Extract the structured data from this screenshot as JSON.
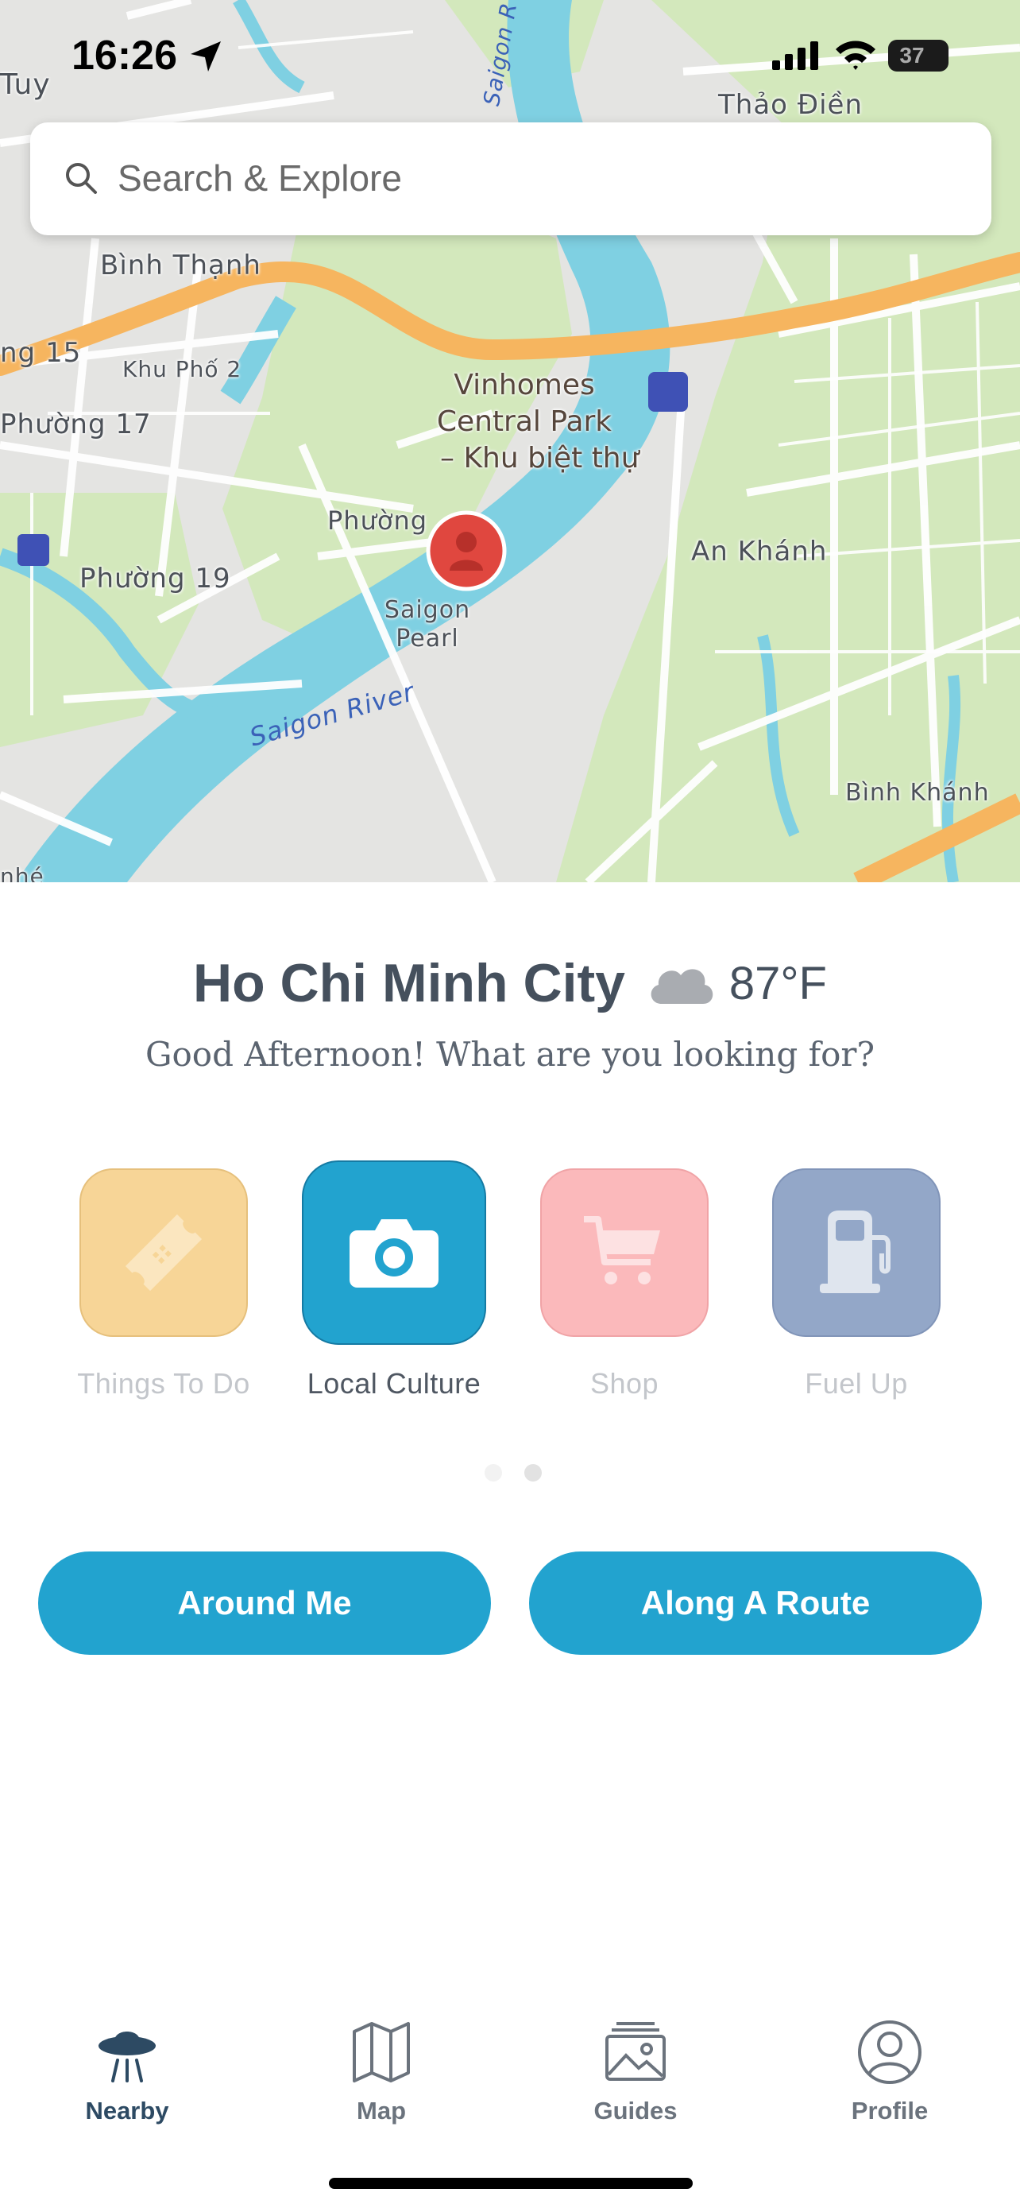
{
  "status_bar": {
    "time": "16:26",
    "battery": "37"
  },
  "search": {
    "placeholder": "Search & Explore",
    "icon": "magnifier-icon"
  },
  "map": {
    "labels": {
      "tuy": "Tuy",
      "thao_dien": "Thảo Điền",
      "binh_thanh": "Bình Thạnh",
      "ng15": "ng 15",
      "khu_pho_2": "Khu Phố 2",
      "phuong17": "Phường 17",
      "poi_line1": "Vinhomes",
      "poi_line2": "Central Park",
      "poi_line3": "– Khu biệt thự",
      "phuong_partial": "Phường",
      "an_khanh": "An Khánh",
      "phuong19": "Phường 19",
      "saigon_pearl_1": "Saigon",
      "saigon_pearl_2": "Pearl",
      "saigon_river": "Saigon River",
      "saigon_r_top": "Saigon R",
      "binh_khanh": "Bình Khánh",
      "nhe": "nhé"
    },
    "colors": {
      "land": "#e4e4e2",
      "park": "#d3e8bc",
      "water": "#7fd0e2",
      "highway": "#f6b55f",
      "road": "#ffffff",
      "pin": "#e0473f"
    }
  },
  "location": {
    "city": "Ho Chi Minh City",
    "temperature": "87°F",
    "weather_icon": "cloud-icon",
    "greeting": "Good Afternoon! What are you looking for?"
  },
  "categories": [
    {
      "label": "Things To Do",
      "icon": "ticket-icon",
      "color": "#f7d597",
      "active": false
    },
    {
      "label": "Local Culture",
      "icon": "camera-icon",
      "color": "#22a3cf",
      "active": true
    },
    {
      "label": "Shop",
      "icon": "cart-icon",
      "color": "#fbb9bb",
      "active": false
    },
    {
      "label": "Fuel Up",
      "icon": "fuel-pump-icon",
      "color": "#93a7c8",
      "active": false
    }
  ],
  "pagination": {
    "pages": 2,
    "current": 2
  },
  "actions": {
    "around_me": "Around Me",
    "along_route": "Along A Route"
  },
  "tabs": [
    {
      "label": "Nearby",
      "icon": "ufo-icon",
      "active": true
    },
    {
      "label": "Map",
      "icon": "map-icon",
      "active": false
    },
    {
      "label": "Guides",
      "icon": "guides-icon",
      "active": false
    },
    {
      "label": "Profile",
      "icon": "profile-icon",
      "active": false
    }
  ]
}
